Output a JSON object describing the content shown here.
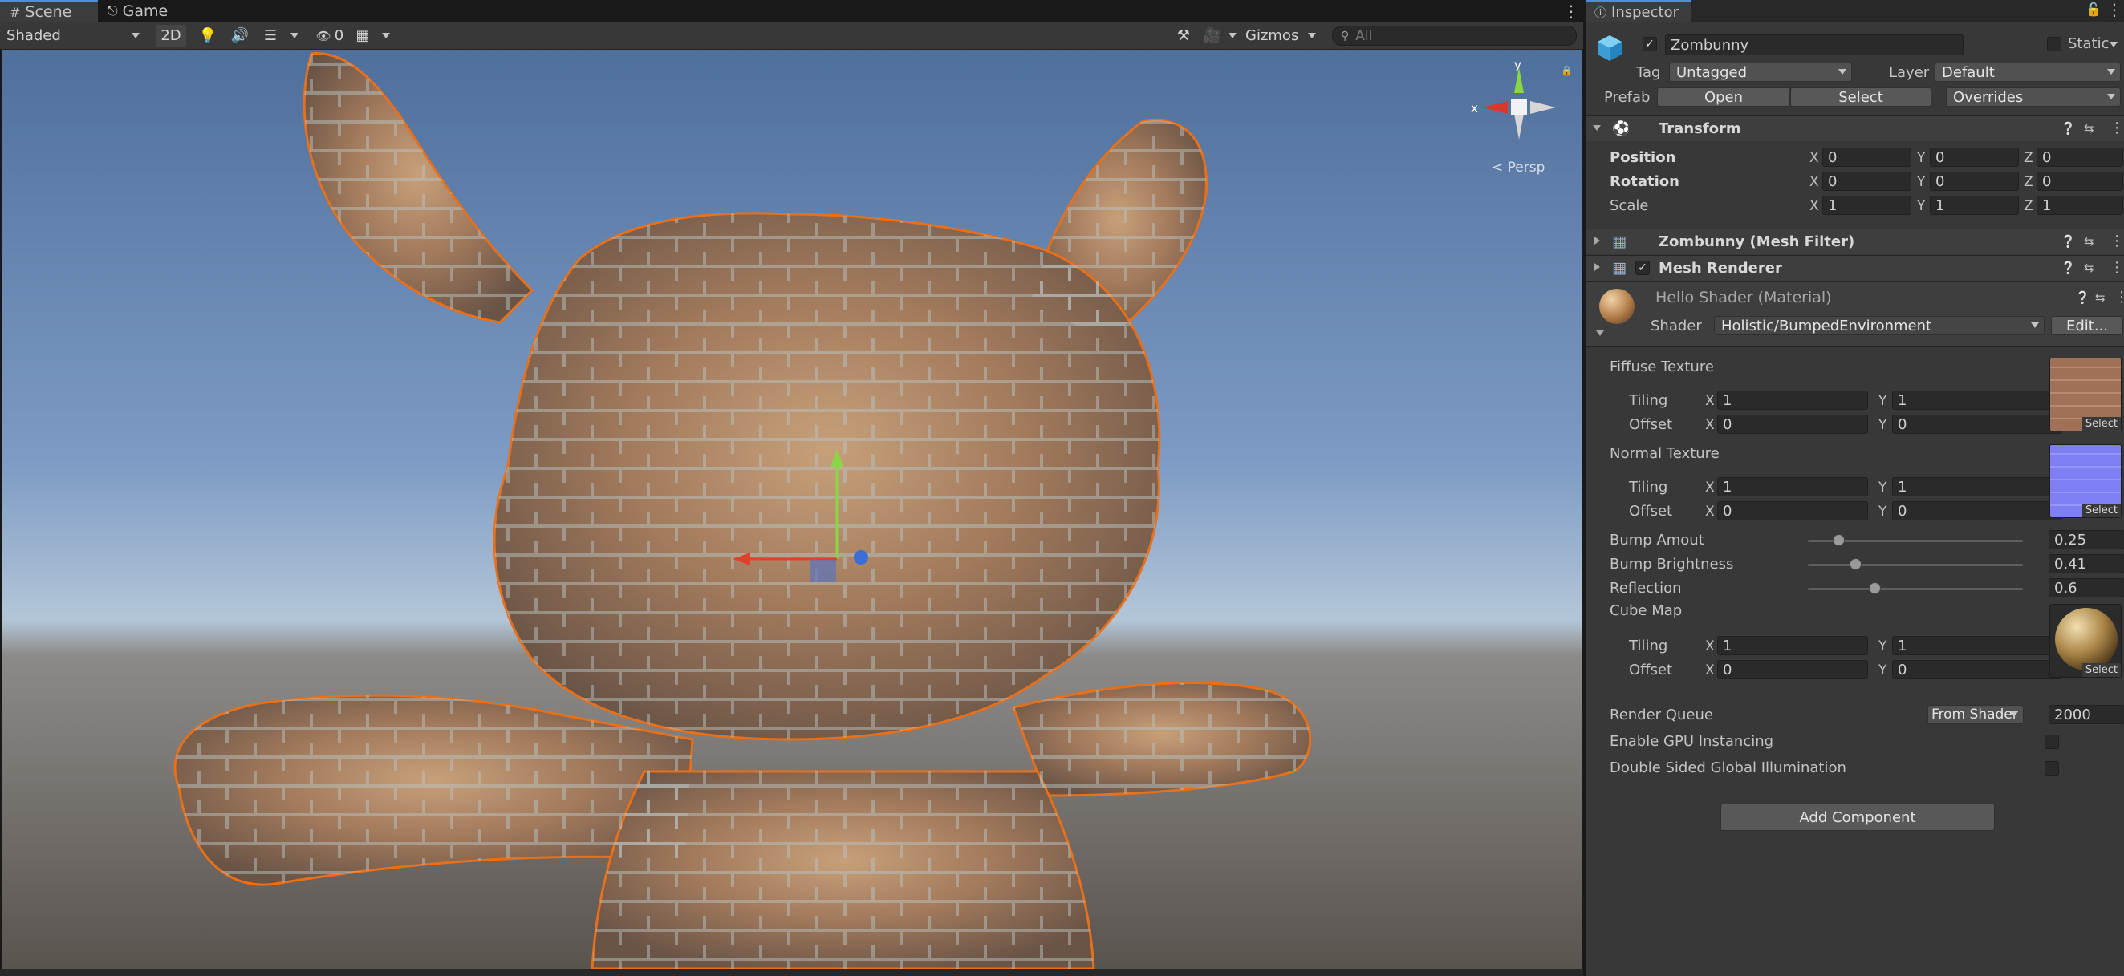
{
  "scene_tabs": [
    {
      "label": "Scene",
      "icon": "grid-icon"
    },
    {
      "label": "Game",
      "icon": "game-controller-icon"
    }
  ],
  "toolbar": {
    "draw_mode": "Shaded",
    "mode_2d": "2D",
    "hidden_count": "0",
    "gizmos": "Gizmos",
    "search_placeholder": "All"
  },
  "scene_view": {
    "persp_label": "< Persp",
    "axis_x": "x",
    "axis_y": "y"
  },
  "inspector": {
    "tab_label": "Inspector",
    "object": {
      "name": "Zombunny",
      "active": true,
      "static_label": "Static",
      "tag_label": "Tag",
      "tag_value": "Untagged",
      "layer_label": "Layer",
      "layer_value": "Default",
      "prefab_label": "Prefab",
      "prefab_open": "Open",
      "prefab_select": "Select",
      "prefab_overrides": "Overrides"
    },
    "transform": {
      "title": "Transform",
      "rows": [
        {
          "label": "Position",
          "x": "0",
          "y": "0",
          "z": "0"
        },
        {
          "label": "Rotation",
          "x": "0",
          "y": "0",
          "z": "0"
        },
        {
          "label": "Scale",
          "x": "1",
          "y": "1",
          "z": "1"
        }
      ]
    },
    "mesh_filter": {
      "title": "Zombunny (Mesh Filter)"
    },
    "mesh_renderer": {
      "title": "Mesh Renderer"
    },
    "material": {
      "title": "Hello Shader (Material)",
      "shader_label": "Shader",
      "shader_value": "Holistic/BumpedEnvironment",
      "edit_button": "Edit...",
      "textures": [
        {
          "label": "Fiffuse Texture",
          "tiling_x": "1",
          "tiling_y": "1",
          "offset_x": "0",
          "offset_y": "0",
          "select": "Select",
          "color": "#9a6a52"
        },
        {
          "label": "Normal Texture",
          "tiling_x": "1",
          "tiling_y": "1",
          "offset_x": "0",
          "offset_y": "0",
          "select": "Select",
          "color": "#7f7ff4"
        }
      ],
      "tiling_label": "Tiling",
      "offset_label": "Offset",
      "x_label": "X",
      "y_label": "Y",
      "sliders": [
        {
          "label": "Bump Amout",
          "value": "0.25",
          "fraction": 0.14
        },
        {
          "label": "Bump Brightness",
          "value": "0.41",
          "fraction": 0.22
        },
        {
          "label": "Reflection",
          "value": "0.6",
          "fraction": 0.31
        }
      ],
      "cube_map": {
        "label": "Cube Map",
        "tiling_x": "1",
        "tiling_y": "1",
        "offset_x": "0",
        "offset_y": "0",
        "select": "Select"
      },
      "render_queue_label": "Render Queue",
      "render_queue_mode": "From Shader",
      "render_queue_value": "2000",
      "gpu_instancing_label": "Enable GPU Instancing",
      "double_sided_gi_label": "Double Sided Global Illumination"
    },
    "add_component": "Add Component"
  }
}
